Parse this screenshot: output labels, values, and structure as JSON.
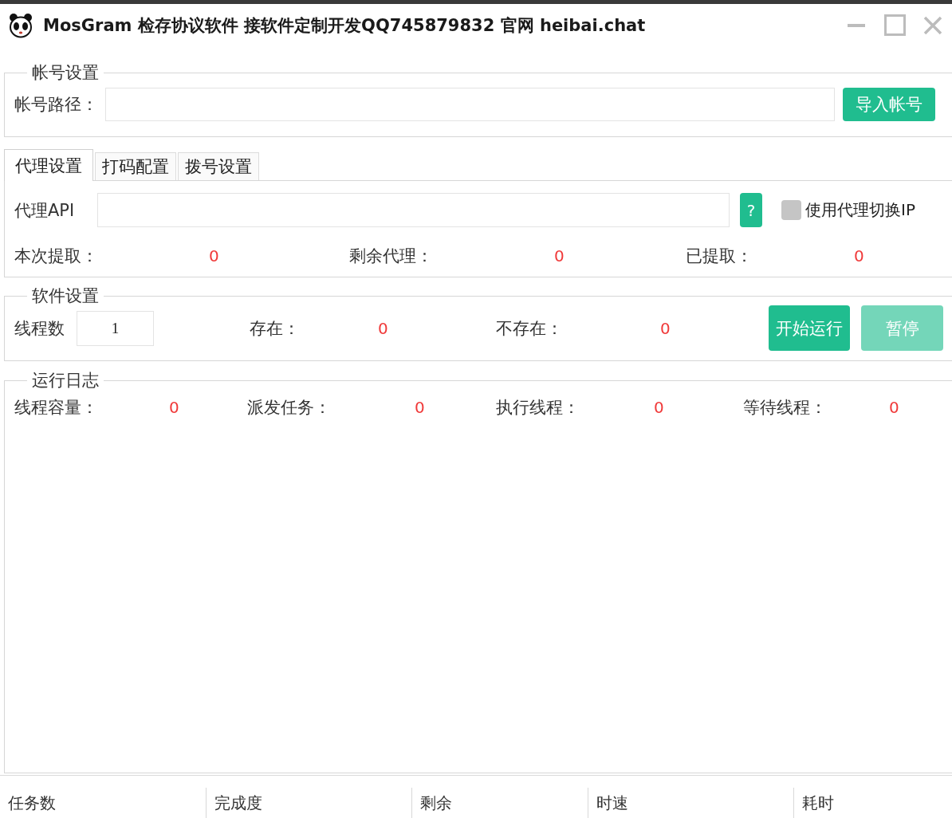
{
  "window": {
    "title": "MosGram 检存协议软件 接软件定制开发QQ745879832 官网 heibai.chat"
  },
  "account_settings": {
    "legend": "帐号设置",
    "path_label": "帐号路径：",
    "import_button": "导入帐号"
  },
  "tabs": [
    {
      "label": "代理设置",
      "selected": true
    },
    {
      "label": "打码配置",
      "selected": false
    },
    {
      "label": "拨号设置",
      "selected": false
    }
  ],
  "proxy": {
    "api_label": "代理API",
    "help_button": "?",
    "switch_ip": {
      "label": "使用代理切换IP",
      "checked": false
    },
    "stats": [
      {
        "label": "本次提取：",
        "value": "0"
      },
      {
        "label": "剩余代理：",
        "value": "0"
      },
      {
        "label": "已提取：",
        "value": "0"
      }
    ]
  },
  "software_settings": {
    "legend": "软件设置",
    "threads_label": "线程数",
    "threads_value": "1",
    "stats": [
      {
        "label": "存在：",
        "value": "0"
      },
      {
        "label": "不存在：",
        "value": "0"
      }
    ],
    "buttons": [
      {
        "label": "开始运行",
        "disabled": false
      },
      {
        "label": "暂停",
        "disabled": true
      }
    ]
  },
  "run_log": {
    "legend": "运行日志",
    "stats": [
      {
        "label": "线程容量：",
        "value": "0"
      },
      {
        "label": "派发任务：",
        "value": "0"
      },
      {
        "label": "执行线程：",
        "value": "0"
      },
      {
        "label": "等待线程：",
        "value": "0"
      }
    ]
  },
  "status_bar": [
    "任务数",
    "完成度",
    "剩余",
    "时速",
    "耗时"
  ]
}
